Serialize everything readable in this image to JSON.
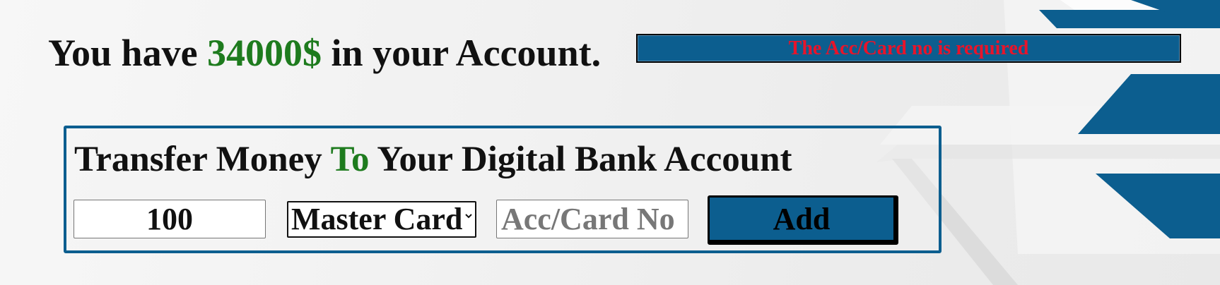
{
  "account": {
    "prefix": "You have",
    "balance": "34000$",
    "suffix": "in your Account."
  },
  "error_message": "The Acc/Card no is required",
  "transfer": {
    "title_part1": "Transfer Money",
    "title_highlight": "To",
    "title_part2": "Your Digital Bank Account",
    "amount_value": "100",
    "card_type_selected": "Master Card",
    "account_placeholder": "Acc/Card No",
    "add_label": "Add"
  },
  "colors": {
    "brand_blue": "#0c5e8f",
    "highlight_green": "#1e7b1e",
    "error_red": "#e8142a"
  }
}
